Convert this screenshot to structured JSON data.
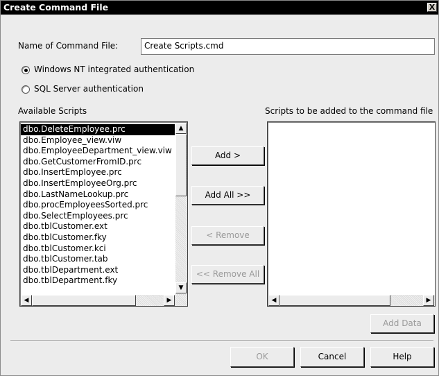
{
  "window": {
    "title": "Create Command File",
    "close_glyph": "X"
  },
  "name_field": {
    "label": "Name of Command File:",
    "value": "Create Scripts.cmd"
  },
  "auth": {
    "option_nt": "Windows NT integrated authentication",
    "option_sql": "SQL Server authentication",
    "selected": "nt"
  },
  "available": {
    "label": "Available Scripts",
    "items": [
      "dbo.DeleteEmployee.prc",
      "dbo.Employee_view.viw",
      "dbo.EmployeeDepartment_view.viw",
      "dbo.GetCustomerFromID.prc",
      "dbo.InsertEmployee.prc",
      "dbo.InsertEmployeeOrg.prc",
      "dbo.LastNameLookup.prc",
      "dbo.procEmployeesSorted.prc",
      "dbo.SelectEmployees.prc",
      "dbo.tblCustomer.ext",
      "dbo.tblCustomer.fky",
      "dbo.tblCustomer.kci",
      "dbo.tblCustomer.tab",
      "dbo.tblDepartment.ext",
      "dbo.tblDepartment.fky"
    ],
    "selected_index": 0
  },
  "target": {
    "label": "Scripts to be added to the command file",
    "items": []
  },
  "buttons": {
    "add": "Add >",
    "add_all": "Add All >>",
    "remove": "< Remove",
    "remove_all": "<< Remove All",
    "add_data": "Add Data",
    "ok": "OK",
    "cancel": "Cancel",
    "help": "Help"
  },
  "icons": {
    "scroll_up": "▲",
    "scroll_down": "▼",
    "scroll_left": "◀",
    "scroll_right": "▶"
  }
}
